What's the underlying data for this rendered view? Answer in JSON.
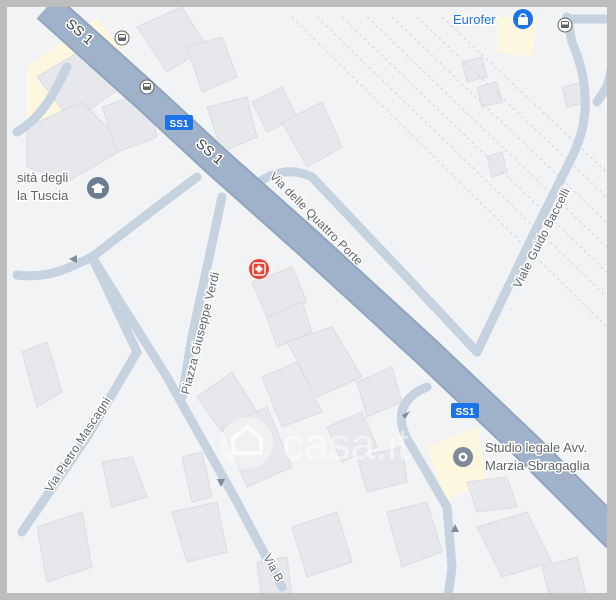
{
  "map": {
    "roads": {
      "ss1_main": "SS 1",
      "ss1_shield": "SS1",
      "quattro_porte": "Via delle Quattro Porte",
      "guido_baccelli": "Viale Guido Baccelli",
      "giuseppe_verdi": "Piazza Giuseppe Verdi",
      "pietro_mascagni": "Via Pietro Mascagni",
      "via_b": "Via B"
    },
    "pois": {
      "university_line1": "sità degli",
      "university_line2": "la Tuscia",
      "eurofer": "Eurofer",
      "studio_line1": "Studio legale Avv.",
      "studio_line2": "Marzia Sbragaglia"
    },
    "icons": {
      "university": "graduation-cap-icon",
      "hospital": "medical-cross-icon",
      "shop": "shopping-bag-icon",
      "place": "place-pin-icon",
      "bus": "bus-stop-icon"
    },
    "colors": {
      "land": "#f1f3f4",
      "building": "#e8eaed",
      "road": "#c7d3e0",
      "highway": "#9aaec6",
      "shield": "#1a73e8",
      "hospital": "#ea4335",
      "park": "#34a853",
      "campus": "#fef7e0"
    },
    "watermark": "casa.it"
  }
}
